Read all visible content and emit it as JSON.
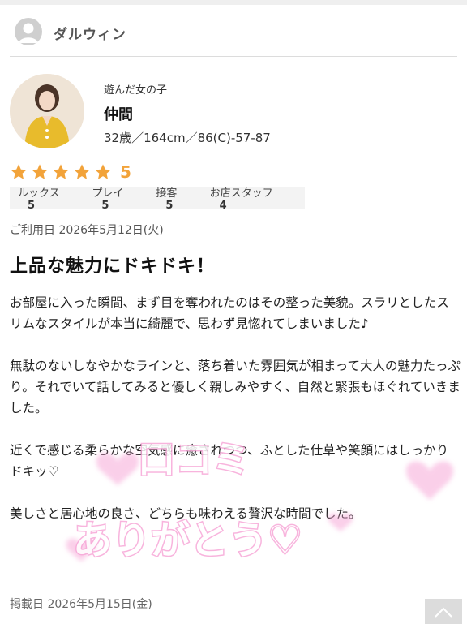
{
  "user": {
    "name": "ダルウィン"
  },
  "girl": {
    "label": "遊んだ女の子",
    "name": "仲間",
    "stats": "32歳／164cm／86(C)-57-87"
  },
  "rating": {
    "overall": "5",
    "star_color": "#f2a33a",
    "items": [
      {
        "label": "ルックス",
        "value": "5"
      },
      {
        "label": "プレイ",
        "value": "5"
      },
      {
        "label": "接客",
        "value": "5"
      },
      {
        "label": "お店スタッフ",
        "value": "4"
      }
    ]
  },
  "review": {
    "visit_date": "ご利用日 2026年5月12日(火)",
    "title": "上品な魅力にドキドキ！",
    "paragraphs": [
      "お部屋に入った瞬間、まず目を奪われたのはその整った美貌。スラリとしたスリムなスタイルが本当に綺麗で、思わず見惚れてしまいました♪",
      "無駄のないしなやかなラインと、落ち着いた雰囲気が相まって大人の魅力たっぷり。それでいて話してみると優しく親しみやすく、自然と緊張もほぐれていきました。",
      "近くで感じる柔らかな空気感に癒されつつ、ふとした仕草や笑顔にはしっかりドキッ♡",
      "美しさと居心地の良さ、どちらも味わえる贅沢な時間でした。"
    ],
    "posted_date": "掲載日 2026年5月15日(金)"
  },
  "stamp": {
    "line1": "口コミ",
    "line2": "ありがとう♡",
    "color": "#f7a8d8"
  },
  "icons": {
    "avatar": "user-avatar-icon",
    "star": "star-icon",
    "scroll": "chevron-up-icon"
  }
}
